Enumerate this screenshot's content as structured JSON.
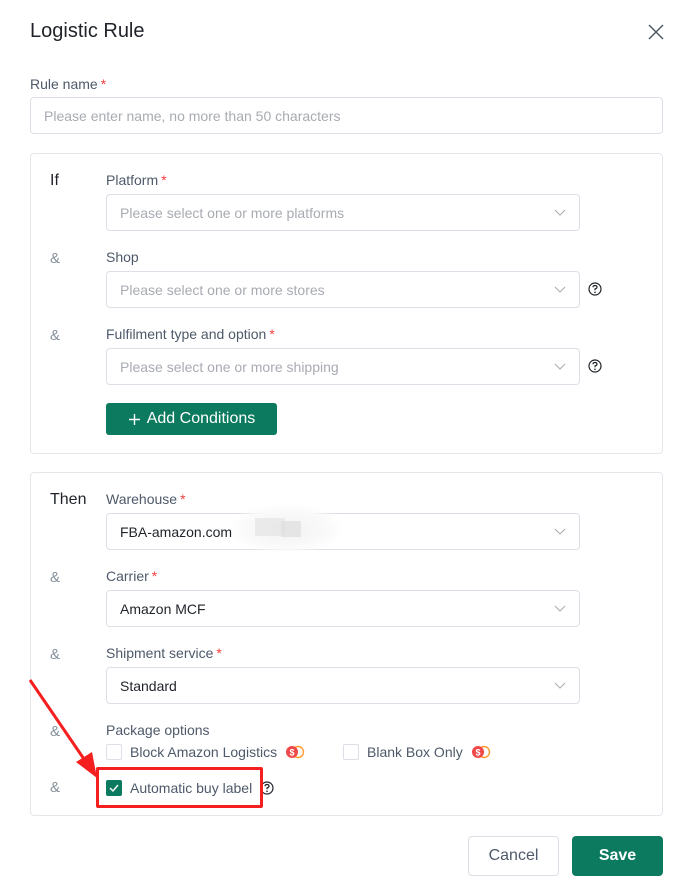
{
  "dialog": {
    "title": "Logistic Rule",
    "close_icon": "close-icon"
  },
  "rule_name": {
    "label": "Rule name",
    "required_mark": "*",
    "placeholder": "Please enter name, no more than 50 characters",
    "value": ""
  },
  "if_section": {
    "keyword": "If",
    "connector": "&",
    "platform": {
      "label": "Platform",
      "required_mark": "*",
      "placeholder": "Please select one or more platforms"
    },
    "shop": {
      "label": "Shop",
      "placeholder": "Please select one or more stores",
      "help_icon": "question-circle-icon"
    },
    "fulfilment": {
      "label": "Fulfilment type and option",
      "required_mark": "*",
      "placeholder": "Please select one or more shipping",
      "help_icon": "question-circle-icon"
    },
    "add_conditions_label": "Add Conditions",
    "add_conditions_icon": "plus-icon"
  },
  "then_section": {
    "keyword": "Then",
    "connector": "&",
    "warehouse": {
      "label": "Warehouse",
      "required_mark": "*",
      "value": "FBA-amazon.com"
    },
    "carrier": {
      "label": "Carrier",
      "required_mark": "*",
      "value": "Amazon MCF"
    },
    "shipment_service": {
      "label": "Shipment service",
      "required_mark": "*",
      "value": "Standard"
    },
    "package_options": {
      "label": "Package options",
      "options": [
        {
          "label": "Block Amazon Logistics",
          "checked": false,
          "badge_icon": "paid-coin-icon"
        },
        {
          "label": "Blank Box Only",
          "checked": false,
          "badge_icon": "paid-coin-icon"
        }
      ]
    },
    "automatic_buy_label": {
      "label": "Automatic buy label",
      "checked": true,
      "help_icon": "question-circle-icon"
    }
  },
  "footer": {
    "cancel_label": "Cancel",
    "save_label": "Save"
  },
  "colors": {
    "primary": "#0b7a5f",
    "required": "#f53f3f",
    "annotation": "#f51f1f",
    "coin_red": "#f04848",
    "coin_orange": "#ff9a2e"
  }
}
